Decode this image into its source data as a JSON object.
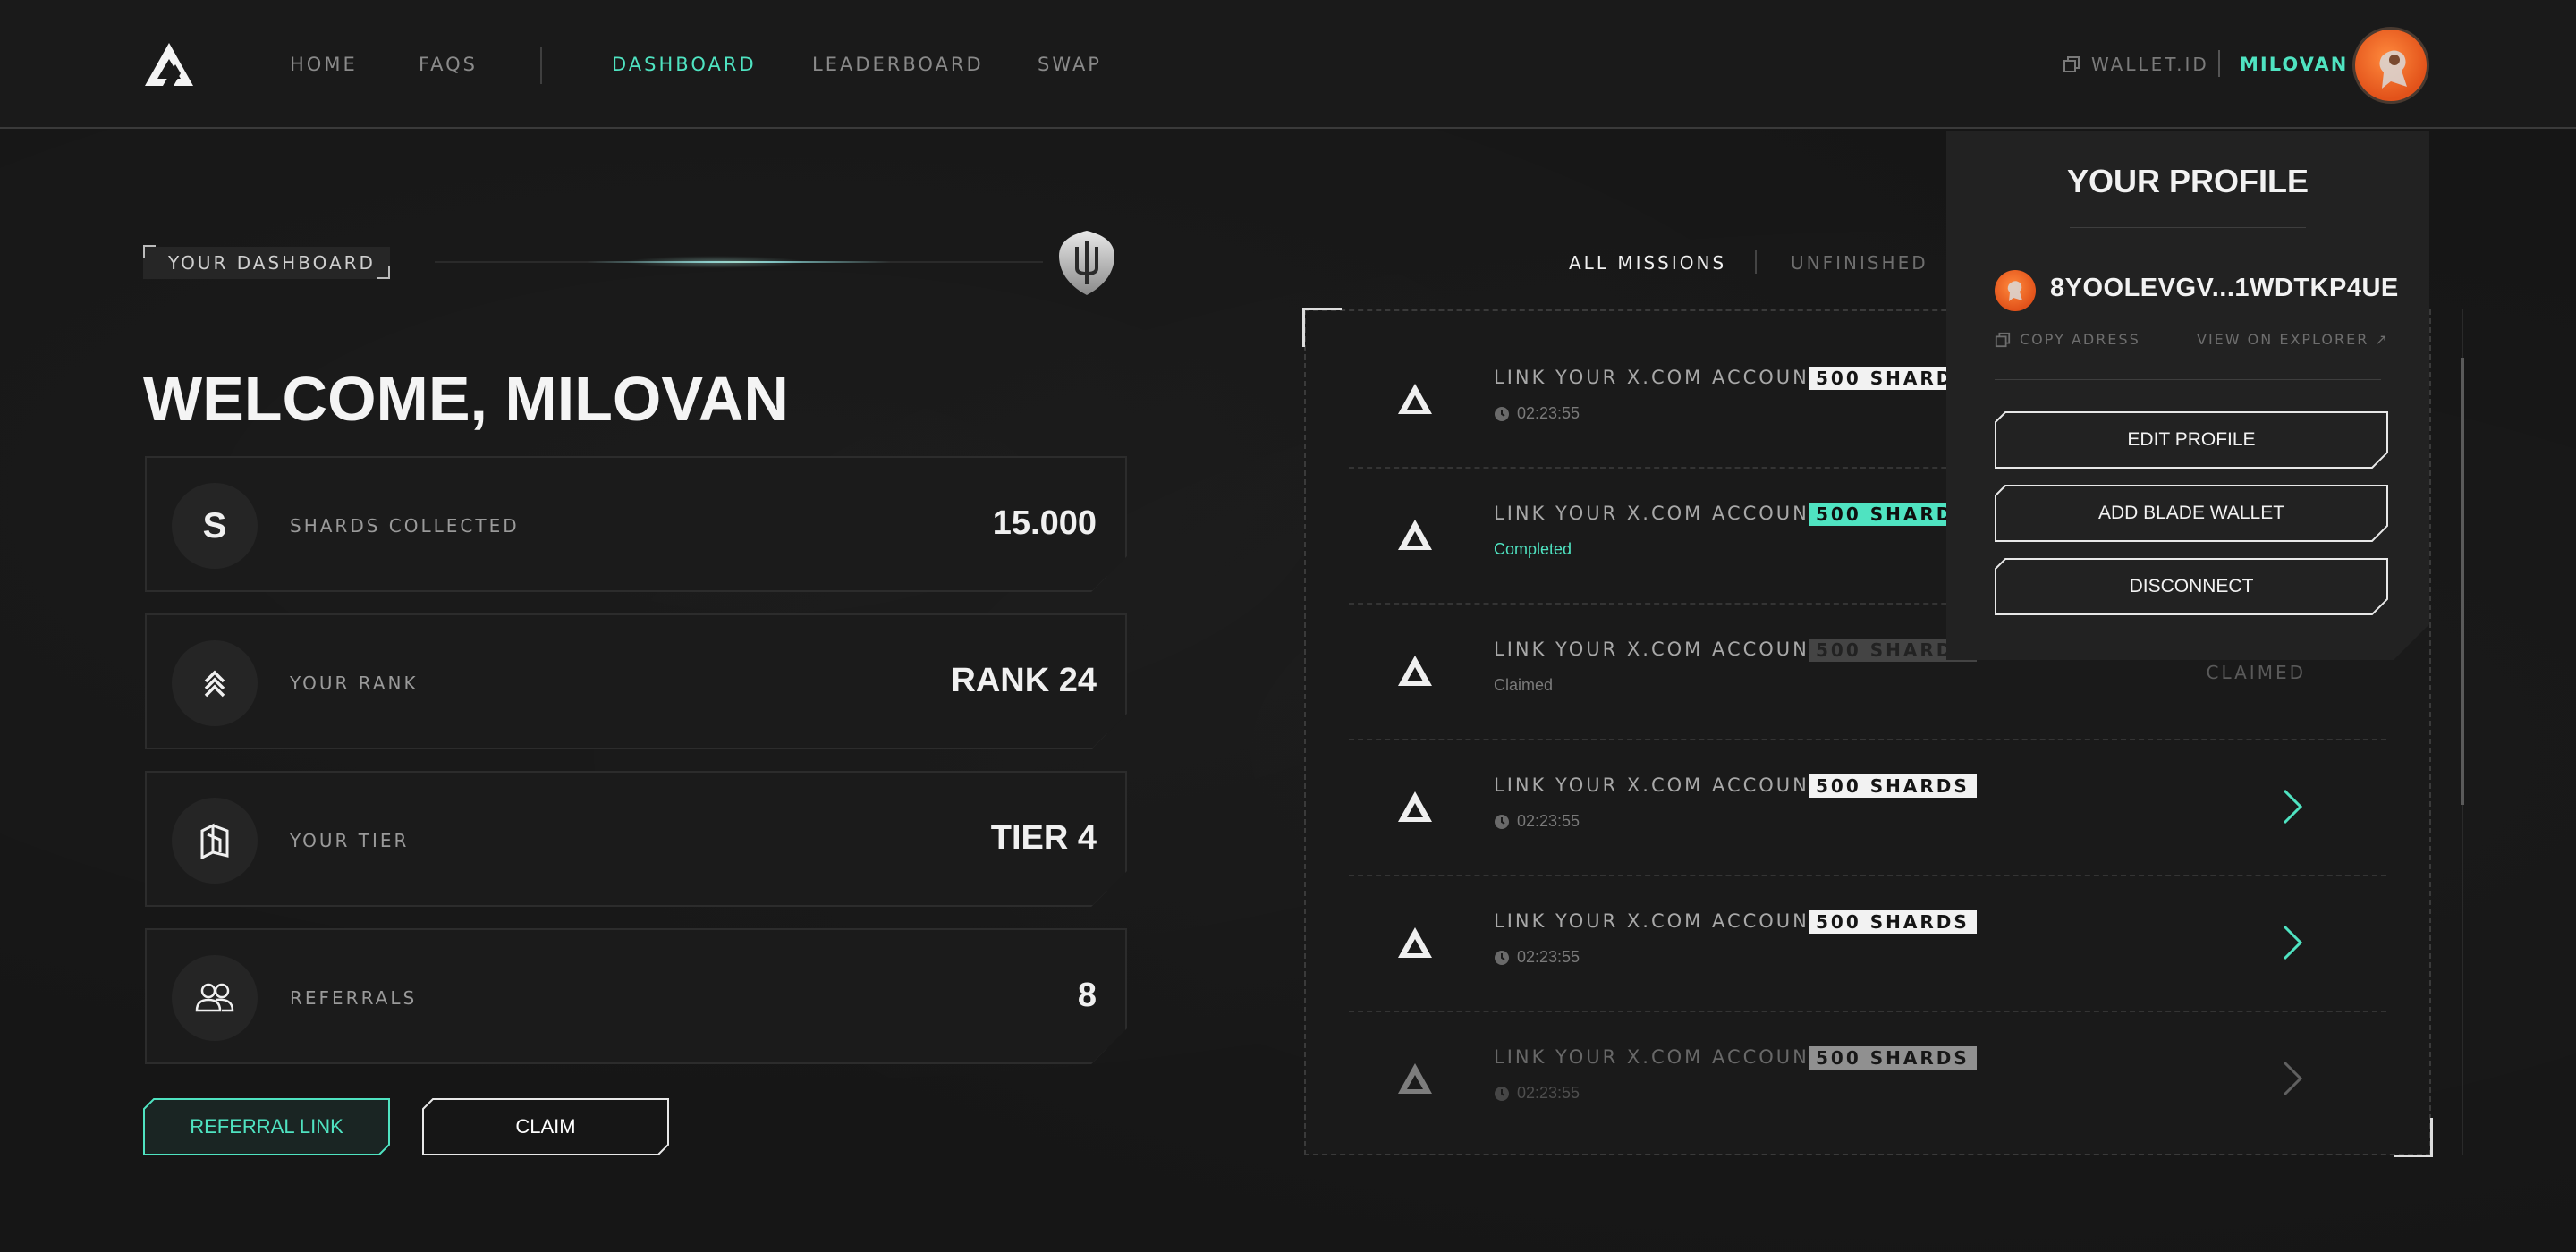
{
  "nav": {
    "items": [
      {
        "label": "HOME",
        "active": false
      },
      {
        "label": "FAQS",
        "active": false
      },
      {
        "label": "DASHBOARD",
        "active": true
      },
      {
        "label": "LEADERBOARD",
        "active": false
      },
      {
        "label": "SWAP",
        "active": false
      }
    ],
    "wallet_id": "WALLET.ID",
    "user_name": "MILOVAN"
  },
  "dashboard": {
    "section_label": "YOUR DASHBOARD",
    "welcome": "WELCOME, MILOVAN",
    "stats": [
      {
        "icon": "shards-s-icon",
        "icon_text": "S",
        "label": "SHARDS COLLECTED",
        "value": "15.000"
      },
      {
        "icon": "rank-chevrons-icon",
        "label": "YOUR RANK",
        "value": "RANK 24"
      },
      {
        "icon": "tier-cubes-icon",
        "label": "YOUR TIER",
        "value": "TIER 4"
      },
      {
        "icon": "users-icon",
        "label": "REFERRALS",
        "value": "8"
      }
    ],
    "referral_button": "REFERRAL LINK",
    "claim_button": "CLAIM"
  },
  "missions": {
    "tabs": [
      {
        "label": "ALL MISSIONS",
        "active": true
      },
      {
        "label": "UNFINISHED",
        "active": false
      }
    ],
    "items": [
      {
        "title": "LINK YOUR X.COM ACCOUNT",
        "badge": "500 SHARDS",
        "state": "pending",
        "sub": "02:23:55"
      },
      {
        "title": "LINK YOUR X.COM ACCOUNT",
        "badge": "500 SHARDS",
        "state": "completed",
        "sub": "Completed"
      },
      {
        "title": "LINK YOUR X.COM ACCOUNT",
        "badge": "500 SHARDS",
        "state": "claimed",
        "sub": "Claimed",
        "status": "CLAIMED"
      },
      {
        "title": "LINK YOUR X.COM ACCOUNT",
        "badge": "500 SHARDS",
        "state": "open",
        "sub": "02:23:55"
      },
      {
        "title": "LINK YOUR X.COM ACCOUNT",
        "badge": "500 SHARDS",
        "state": "open",
        "sub": "02:23:55"
      },
      {
        "title": "LINK YOUR X.COM ACCOUNT",
        "badge": "500 SHARDS",
        "state": "open-faded",
        "sub": "02:23:55"
      }
    ]
  },
  "profile": {
    "title": "YOUR PROFILE",
    "address": "8YOOLEVGV...1WDTKP4UE",
    "copy_label": "COPY ADRESS",
    "explorer_label": "VIEW ON EXPLORER ↗",
    "buttons": [
      "EDIT PROFILE",
      "ADD BLADE WALLET",
      "DISCONNECT"
    ]
  },
  "colors": {
    "accent": "#4fe3c1",
    "background": "#161616",
    "avatar": "#e2521a"
  }
}
